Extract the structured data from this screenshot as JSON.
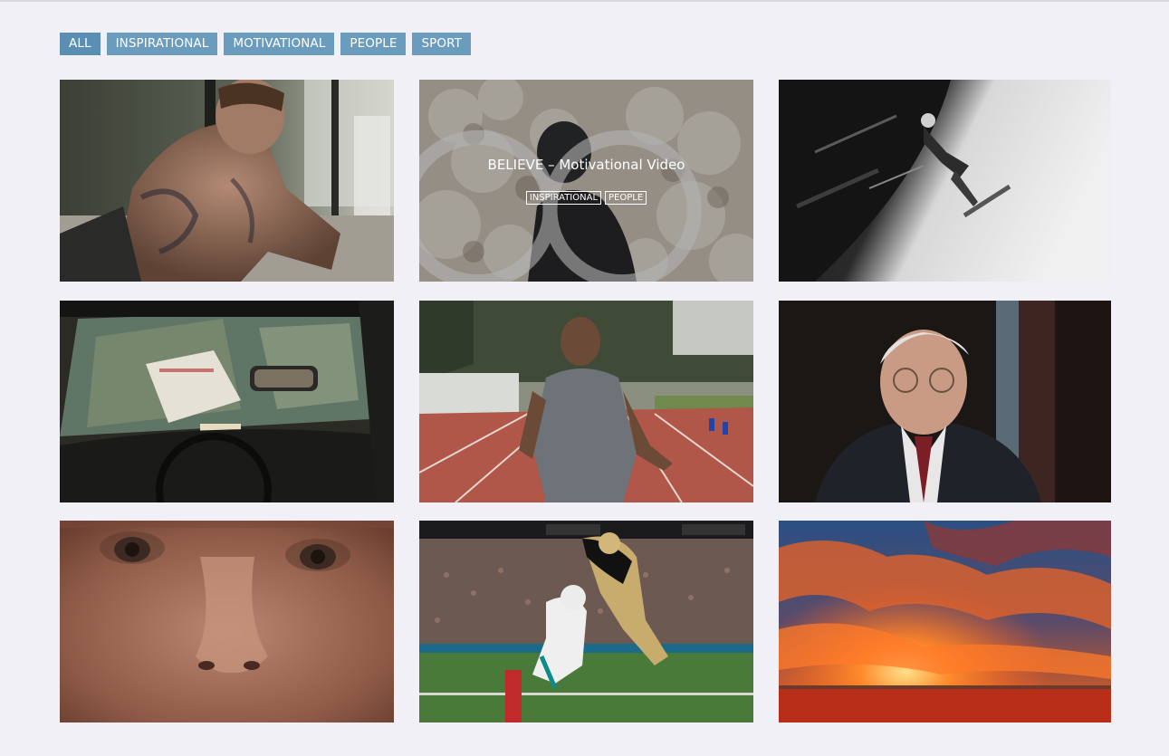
{
  "filters": {
    "items": [
      {
        "label": "ALL"
      },
      {
        "label": "INSPIRATIONAL"
      },
      {
        "label": "MOTIVATIONAL"
      },
      {
        "label": "PEOPLE"
      },
      {
        "label": "SPORT"
      }
    ]
  },
  "gallery": {
    "tiles": [
      {
        "id": 1,
        "subject": "tattooed man leaning on bench"
      },
      {
        "id": 2,
        "subject": "silhouette of man against cotton clouds",
        "hover": {
          "title": "BELIEVE – Motivational Video",
          "tags": [
            "INSPIRATIONAL",
            "PEOPLE"
          ]
        }
      },
      {
        "id": 3,
        "subject": "skateboarder in black and white bowl"
      },
      {
        "id": 4,
        "subject": "taxi interior with newspaper on dashboard"
      },
      {
        "id": 5,
        "subject": "athlete running on track"
      },
      {
        "id": 6,
        "subject": "elderly man in suit interview"
      },
      {
        "id": 7,
        "subject": "close-up of face"
      },
      {
        "id": 8,
        "subject": "football players touchdown leap"
      },
      {
        "id": 9,
        "subject": "orange sunset over horizon"
      }
    ]
  },
  "colors": {
    "background": "#f1f0f6",
    "filter_button": "#6b9cbd",
    "filter_text": "#ffffff"
  }
}
